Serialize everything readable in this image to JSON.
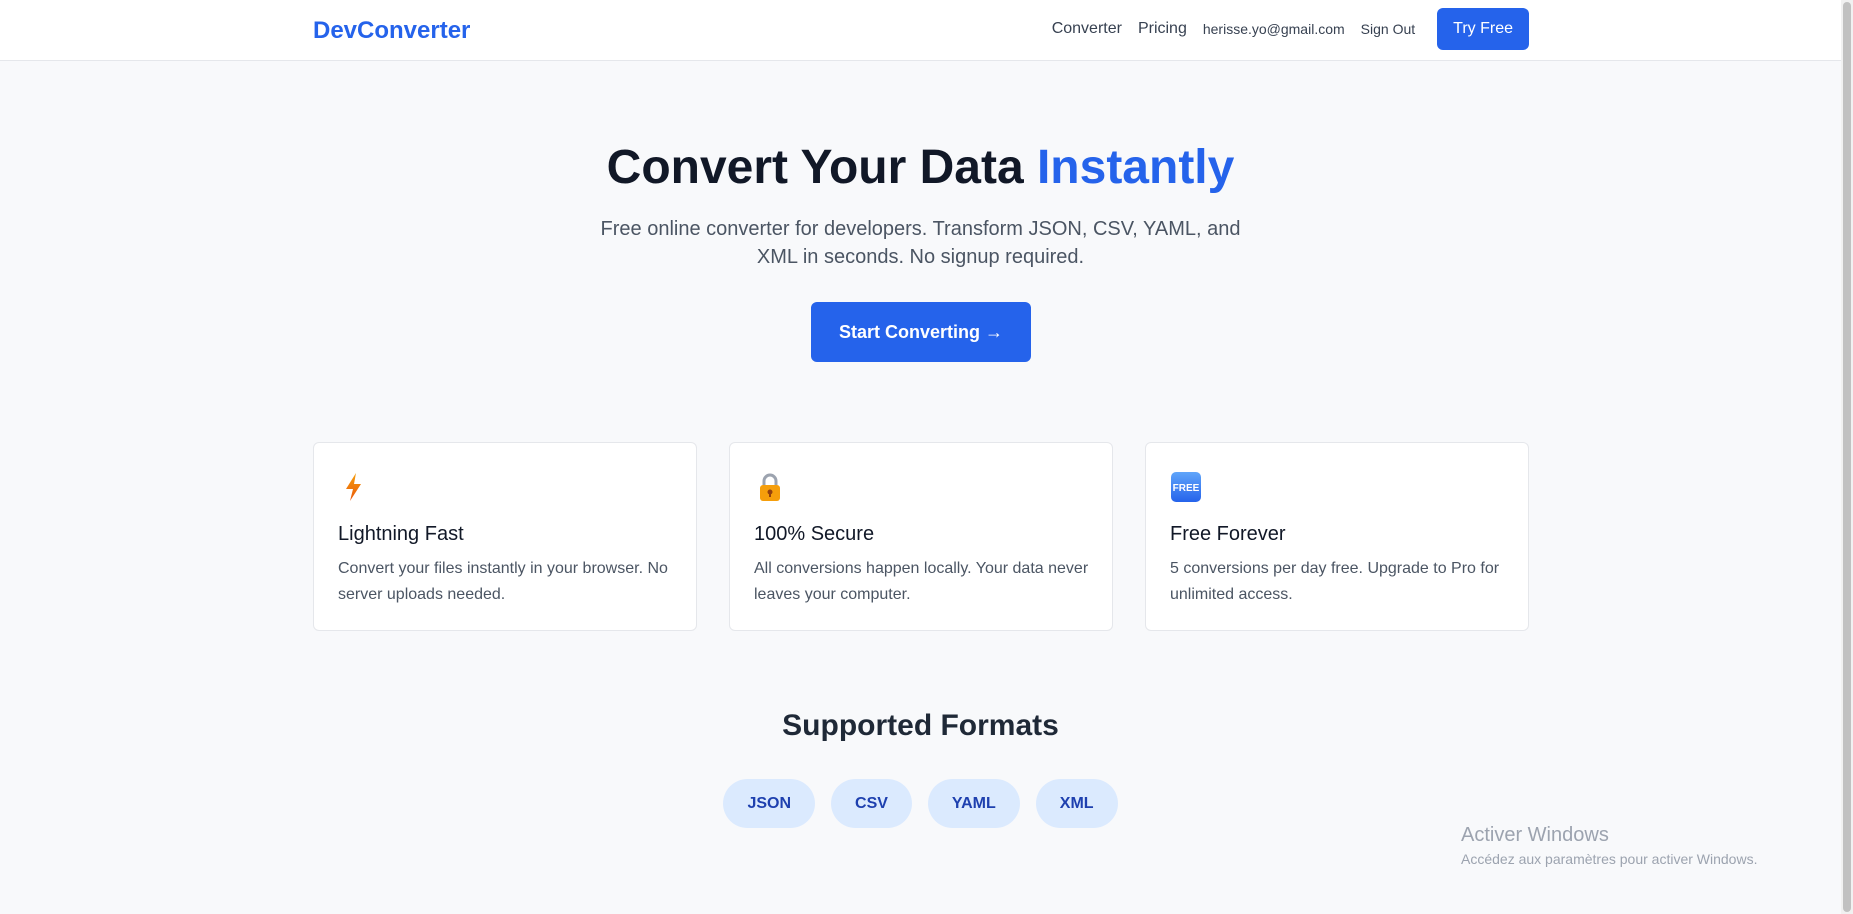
{
  "header": {
    "brand": "DevConverter",
    "nav": {
      "converter": "Converter",
      "pricing": "Pricing"
    },
    "user_email": "herisse.yo@gmail.com",
    "sign_out": "Sign Out",
    "try_free": "Try Free"
  },
  "hero": {
    "title_main": "Convert Your Data ",
    "title_accent": "Instantly",
    "subtitle": "Free online converter for developers. Transform JSON, CSV, YAML, and XML in seconds. No signup required.",
    "cta": "Start Converting →"
  },
  "features": [
    {
      "icon": "lightning-icon",
      "title": "Lightning Fast",
      "desc": "Convert your files instantly in your browser. No server uploads needed."
    },
    {
      "icon": "lock-icon",
      "title": "100% Secure",
      "desc": "All conversions happen locally. Your data never leaves your computer."
    },
    {
      "icon": "free-badge-icon",
      "icon_text": "FREE",
      "title": "Free Forever",
      "desc": "5 conversions per day free. Upgrade to Pro for unlimited access."
    }
  ],
  "formats": {
    "title": "Supported Formats",
    "items": [
      "JSON",
      "CSV",
      "YAML",
      "XML"
    ]
  },
  "watermark": {
    "title": "Activer Windows",
    "subtitle": "Accédez aux paramètres pour activer Windows."
  },
  "colors": {
    "accent": "#2563eb",
    "pill_bg": "#dbeafe",
    "pill_text": "#1e40af"
  }
}
